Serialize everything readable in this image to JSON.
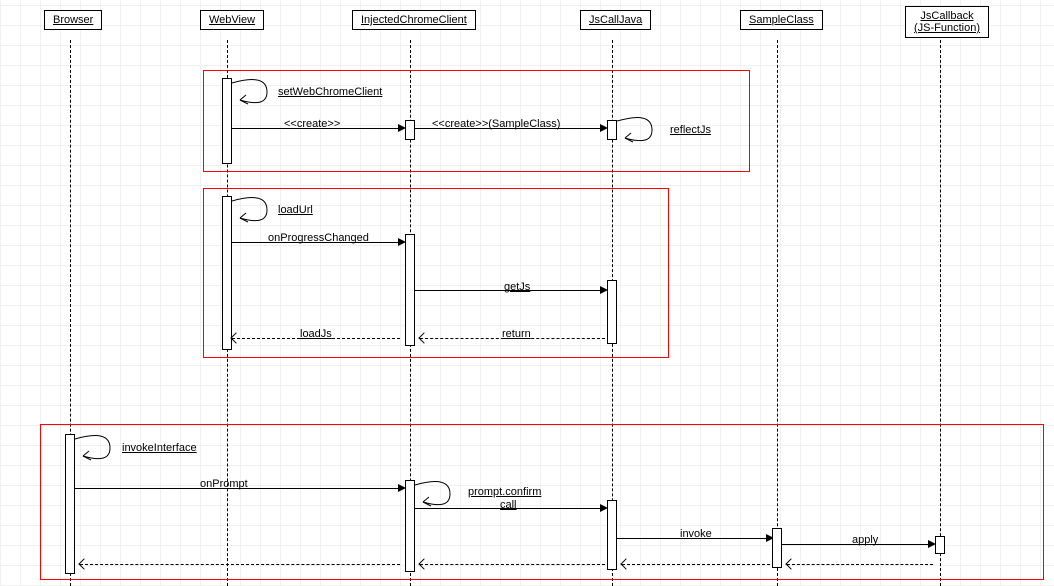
{
  "participants": {
    "browser": "Browser",
    "webview": "WebView",
    "injected": "InjectedChromeClient",
    "jscalljava": "JsCallJava",
    "sampleclass": "SampleClass",
    "jscallback": "JsCallback\n(JS-Function)"
  },
  "frame1": {
    "selfmsg": "setWebChromeClient",
    "create1": "<<create>>",
    "create2": "<<create>>(SampleClass)",
    "reflect": "reflectJs"
  },
  "frame2": {
    "selfmsg": "loadUrl",
    "onprogress": "onProgressChanged",
    "getjs": "getJs",
    "loadjs": "loadJs",
    "return": "return"
  },
  "frame3": {
    "selfmsg": "invokeInterface",
    "onprompt": "onPrompt",
    "promptconfirm": "prompt.confirm",
    "call": "call",
    "invoke": "invoke",
    "apply": "apply"
  }
}
